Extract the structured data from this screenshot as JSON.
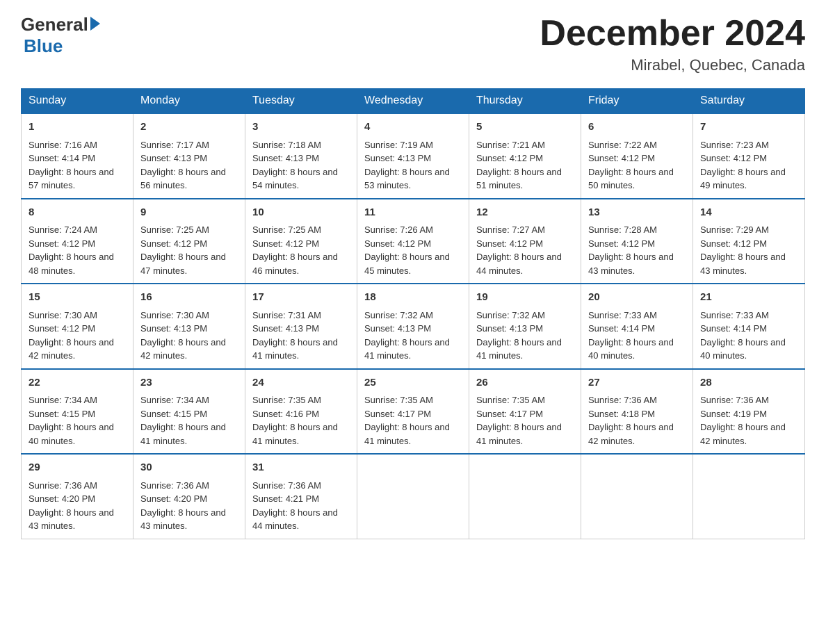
{
  "header": {
    "logo_general": "General",
    "logo_blue": "Blue",
    "month_title": "December 2024",
    "location": "Mirabel, Quebec, Canada"
  },
  "days_of_week": [
    "Sunday",
    "Monday",
    "Tuesday",
    "Wednesday",
    "Thursday",
    "Friday",
    "Saturday"
  ],
  "weeks": [
    [
      {
        "day": 1,
        "sunrise": "7:16 AM",
        "sunset": "4:14 PM",
        "daylight": "8 hours and 57 minutes."
      },
      {
        "day": 2,
        "sunrise": "7:17 AM",
        "sunset": "4:13 PM",
        "daylight": "8 hours and 56 minutes."
      },
      {
        "day": 3,
        "sunrise": "7:18 AM",
        "sunset": "4:13 PM",
        "daylight": "8 hours and 54 minutes."
      },
      {
        "day": 4,
        "sunrise": "7:19 AM",
        "sunset": "4:13 PM",
        "daylight": "8 hours and 53 minutes."
      },
      {
        "day": 5,
        "sunrise": "7:21 AM",
        "sunset": "4:12 PM",
        "daylight": "8 hours and 51 minutes."
      },
      {
        "day": 6,
        "sunrise": "7:22 AM",
        "sunset": "4:12 PM",
        "daylight": "8 hours and 50 minutes."
      },
      {
        "day": 7,
        "sunrise": "7:23 AM",
        "sunset": "4:12 PM",
        "daylight": "8 hours and 49 minutes."
      }
    ],
    [
      {
        "day": 8,
        "sunrise": "7:24 AM",
        "sunset": "4:12 PM",
        "daylight": "8 hours and 48 minutes."
      },
      {
        "day": 9,
        "sunrise": "7:25 AM",
        "sunset": "4:12 PM",
        "daylight": "8 hours and 47 minutes."
      },
      {
        "day": 10,
        "sunrise": "7:25 AM",
        "sunset": "4:12 PM",
        "daylight": "8 hours and 46 minutes."
      },
      {
        "day": 11,
        "sunrise": "7:26 AM",
        "sunset": "4:12 PM",
        "daylight": "8 hours and 45 minutes."
      },
      {
        "day": 12,
        "sunrise": "7:27 AM",
        "sunset": "4:12 PM",
        "daylight": "8 hours and 44 minutes."
      },
      {
        "day": 13,
        "sunrise": "7:28 AM",
        "sunset": "4:12 PM",
        "daylight": "8 hours and 43 minutes."
      },
      {
        "day": 14,
        "sunrise": "7:29 AM",
        "sunset": "4:12 PM",
        "daylight": "8 hours and 43 minutes."
      }
    ],
    [
      {
        "day": 15,
        "sunrise": "7:30 AM",
        "sunset": "4:12 PM",
        "daylight": "8 hours and 42 minutes."
      },
      {
        "day": 16,
        "sunrise": "7:30 AM",
        "sunset": "4:13 PM",
        "daylight": "8 hours and 42 minutes."
      },
      {
        "day": 17,
        "sunrise": "7:31 AM",
        "sunset": "4:13 PM",
        "daylight": "8 hours and 41 minutes."
      },
      {
        "day": 18,
        "sunrise": "7:32 AM",
        "sunset": "4:13 PM",
        "daylight": "8 hours and 41 minutes."
      },
      {
        "day": 19,
        "sunrise": "7:32 AM",
        "sunset": "4:13 PM",
        "daylight": "8 hours and 41 minutes."
      },
      {
        "day": 20,
        "sunrise": "7:33 AM",
        "sunset": "4:14 PM",
        "daylight": "8 hours and 40 minutes."
      },
      {
        "day": 21,
        "sunrise": "7:33 AM",
        "sunset": "4:14 PM",
        "daylight": "8 hours and 40 minutes."
      }
    ],
    [
      {
        "day": 22,
        "sunrise": "7:34 AM",
        "sunset": "4:15 PM",
        "daylight": "8 hours and 40 minutes."
      },
      {
        "day": 23,
        "sunrise": "7:34 AM",
        "sunset": "4:15 PM",
        "daylight": "8 hours and 41 minutes."
      },
      {
        "day": 24,
        "sunrise": "7:35 AM",
        "sunset": "4:16 PM",
        "daylight": "8 hours and 41 minutes."
      },
      {
        "day": 25,
        "sunrise": "7:35 AM",
        "sunset": "4:17 PM",
        "daylight": "8 hours and 41 minutes."
      },
      {
        "day": 26,
        "sunrise": "7:35 AM",
        "sunset": "4:17 PM",
        "daylight": "8 hours and 41 minutes."
      },
      {
        "day": 27,
        "sunrise": "7:36 AM",
        "sunset": "4:18 PM",
        "daylight": "8 hours and 42 minutes."
      },
      {
        "day": 28,
        "sunrise": "7:36 AM",
        "sunset": "4:19 PM",
        "daylight": "8 hours and 42 minutes."
      }
    ],
    [
      {
        "day": 29,
        "sunrise": "7:36 AM",
        "sunset": "4:20 PM",
        "daylight": "8 hours and 43 minutes."
      },
      {
        "day": 30,
        "sunrise": "7:36 AM",
        "sunset": "4:20 PM",
        "daylight": "8 hours and 43 minutes."
      },
      {
        "day": 31,
        "sunrise": "7:36 AM",
        "sunset": "4:21 PM",
        "daylight": "8 hours and 44 minutes."
      },
      null,
      null,
      null,
      null
    ]
  ]
}
